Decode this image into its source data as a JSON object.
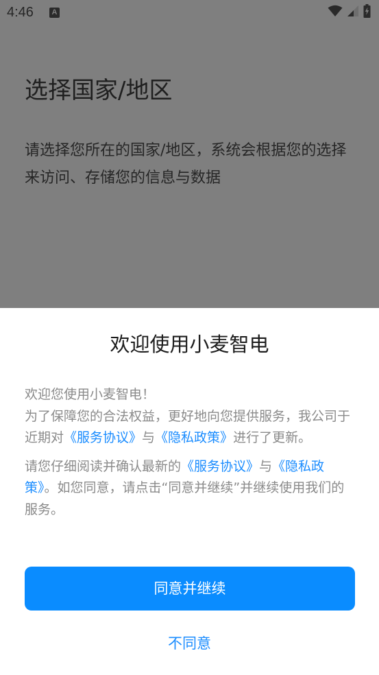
{
  "status_bar": {
    "time": "4:46",
    "notification_letter": "A",
    "icons": [
      "wifi-icon",
      "signal-icon",
      "battery-charging-icon"
    ]
  },
  "background_page": {
    "title": "选择国家/地区",
    "description": "请选择您所在的国家/地区，系统会根据您的选择来访问、存储您的信息与数据"
  },
  "dialog": {
    "title": "欢迎使用小麦智电",
    "paragraph1": {
      "line1": "欢迎您使用小麦智电！",
      "text_before": "为了保障您的合法权益，更好地向您提供服务，我公司于近期对",
      "link1": "《服务协议》",
      "text_between": "与",
      "link2": "《隐私政策》",
      "text_after": "进行了更新。"
    },
    "paragraph2": {
      "text_before": "请您仔细阅读并确认最新的",
      "link1": "《服务协议》",
      "text_between": "与",
      "link2": "《隐私政策》",
      "text_after": "。如您同意，请点击“同意并继续”并继续使用我们的服务。"
    },
    "agree_button": "同意并继续",
    "disagree_button": "不同意"
  },
  "colors": {
    "accent": "#0a8cff",
    "link": "#1a8cff",
    "scrim": "#7f7f7f",
    "body_text": "#8a8a8a"
  }
}
